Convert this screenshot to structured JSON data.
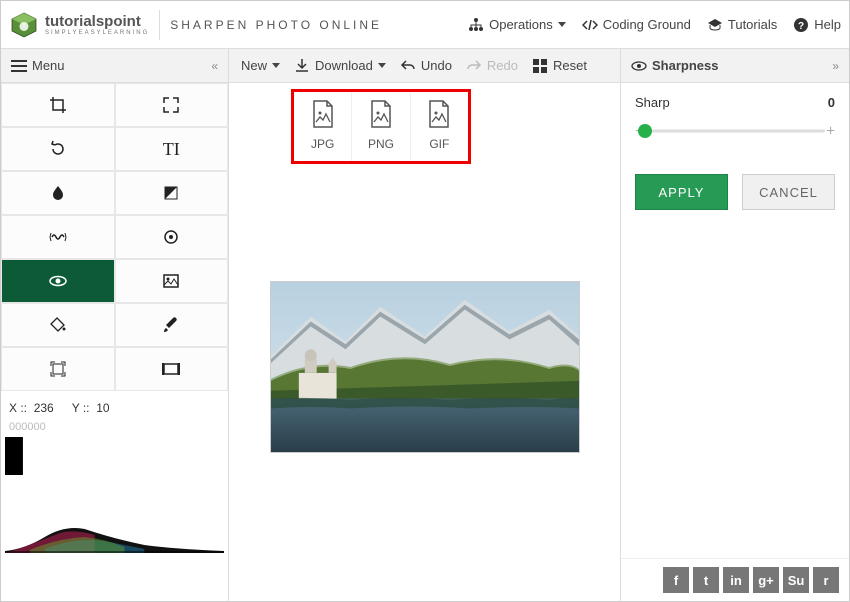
{
  "header": {
    "brand": "tutorialspoint",
    "brand_sub": "SIMPLYEASYLEARNING",
    "tagline": "SHARPEN PHOTO ONLINE",
    "nav": {
      "operations": "Operations",
      "coding_ground": "Coding Ground",
      "tutorials": "Tutorials",
      "help": "Help"
    }
  },
  "subbar": {
    "menu_label": "Menu",
    "new_label": "New",
    "download_label": "Download",
    "undo_label": "Undo",
    "redo_label": "Redo",
    "reset_label": "Reset",
    "sharpness_label": "Sharpness"
  },
  "tools": [
    {
      "name": "crop-icon"
    },
    {
      "name": "expand-icon"
    },
    {
      "name": "rotate-left-icon"
    },
    {
      "name": "text-icon"
    },
    {
      "name": "drop-icon"
    },
    {
      "name": "contrast-icon"
    },
    {
      "name": "vibration-icon"
    },
    {
      "name": "target-icon"
    },
    {
      "name": "eye-icon",
      "active": true
    },
    {
      "name": "image-frame-icon"
    },
    {
      "name": "paint-bucket-icon"
    },
    {
      "name": "brush-icon"
    },
    {
      "name": "focus-icon"
    },
    {
      "name": "frame-icon"
    }
  ],
  "coords": {
    "x_label": "X ::",
    "x_val": "236",
    "y_label": "Y ::",
    "y_val": "10"
  },
  "zero_pad": "000000",
  "download_options": [
    {
      "label": "JPG",
      "name": "download-jpg"
    },
    {
      "label": "PNG",
      "name": "download-png"
    },
    {
      "label": "GIF",
      "name": "download-gif"
    }
  ],
  "panel": {
    "sharp_label": "Sharp",
    "sharp_value": "0",
    "apply_label": "APPLY",
    "cancel_label": "CANCEL"
  },
  "social": [
    "f",
    "t",
    "in",
    "g+",
    "Su",
    "r"
  ]
}
